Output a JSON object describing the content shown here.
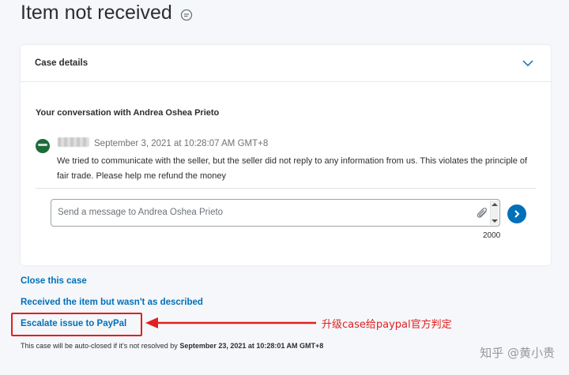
{
  "page": {
    "title": "Item not received"
  },
  "case_details": {
    "header": "Case details",
    "conversation_title": "Your conversation with Andrea Oshea Prieto",
    "message": {
      "timestamp": "September 3, 2021 at 10:28:07 AM GMT+8",
      "body": "We tried to communicate with the seller, but the seller did not reply to any information from us. This violates the principle of fair trade. Please help me refund the money"
    },
    "input": {
      "placeholder": "Send a message to Andrea Oshea Prieto",
      "char_count": "2000"
    }
  },
  "actions": {
    "close_case": "Close this case",
    "not_as_described": "Received the item but wasn't as described",
    "escalate": "Escalate issue to PayPal"
  },
  "annotation": {
    "text": "升级case给paypal官方判定",
    "color": "#e02020"
  },
  "footer": {
    "note_prefix": "This case will be auto-closed if it's not resolved by ",
    "note_date": "September 23, 2021 at 10:28:01 AM GMT+8"
  },
  "watermark": {
    "text": "知乎 @黄小贵"
  },
  "colors": {
    "link": "#0070ba",
    "background": "#f5f7fa",
    "card": "#ffffff"
  }
}
